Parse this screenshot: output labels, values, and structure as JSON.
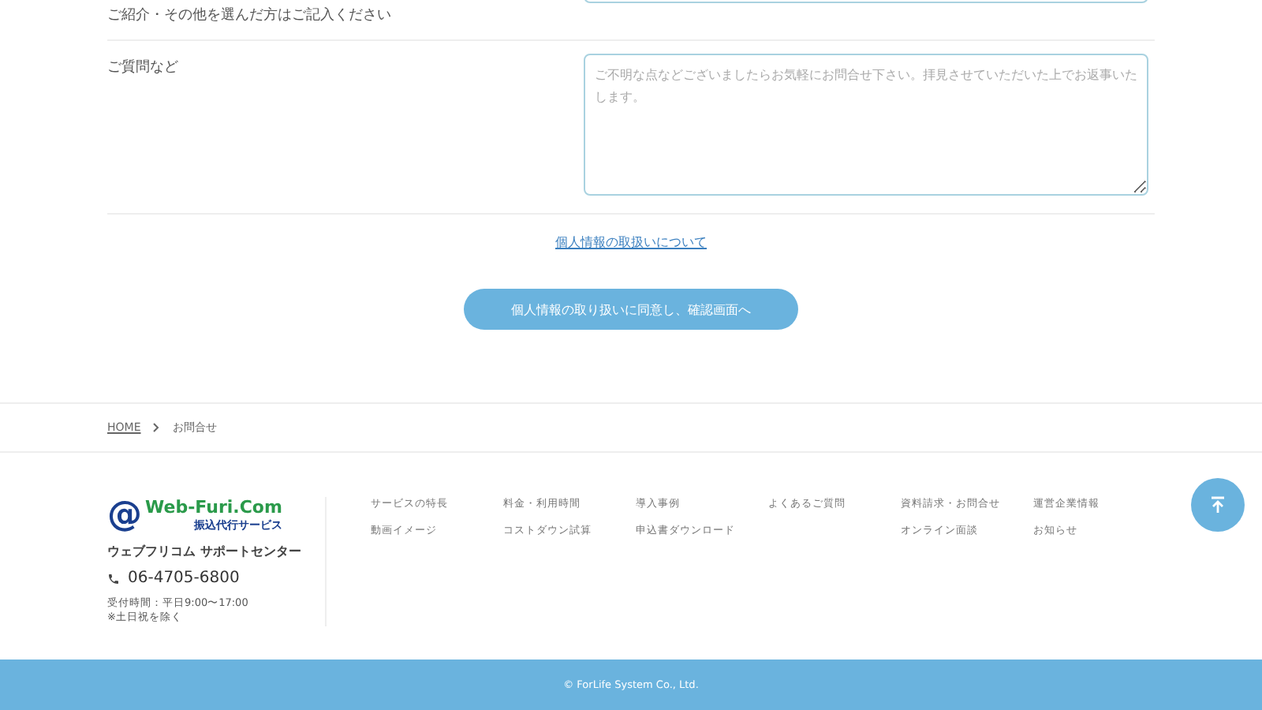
{
  "form": {
    "rows": [
      {
        "label": "ご紹介・その他を選んだ方はご記入ください",
        "kind": "input",
        "placeholder": ""
      },
      {
        "label": "ご質問など",
        "kind": "textarea",
        "placeholder": "ご不明な点などございましたらお気軽にお問合せ下さい。拝見させていただいた上でお返事いたします。"
      }
    ],
    "privacy_link": "個人情報の取扱いについて",
    "submit_button": "個人情報の取り扱いに同意し、確認画面へ"
  },
  "breadcrumb": [
    {
      "label": "HOME",
      "link": true
    },
    {
      "label": "お問合せ",
      "link": false
    }
  ],
  "footer": {
    "logo": {
      "mark": "@",
      "main": "Web-Furi.Com",
      "sub": "振込代行サービス"
    },
    "center": "ウェブフリコム サポートセンター",
    "phone": "06-4705-6800",
    "hours": "受付時間：平日9:00〜17:00",
    "note": "※土日祝を除く",
    "link_columns": [
      [
        "サービスの特長",
        "動画イメージ"
      ],
      [
        "料金・利用時間",
        "コストダウン試算"
      ],
      [
        "導入事例",
        "申込書ダウンロード"
      ],
      [
        "よくあるご質問"
      ],
      [
        "資料請求・お問合せ",
        "オンライン面談"
      ],
      [
        "運営企業情報",
        "お知らせ"
      ]
    ],
    "copyright": "© ForLife System Co., Ltd."
  }
}
